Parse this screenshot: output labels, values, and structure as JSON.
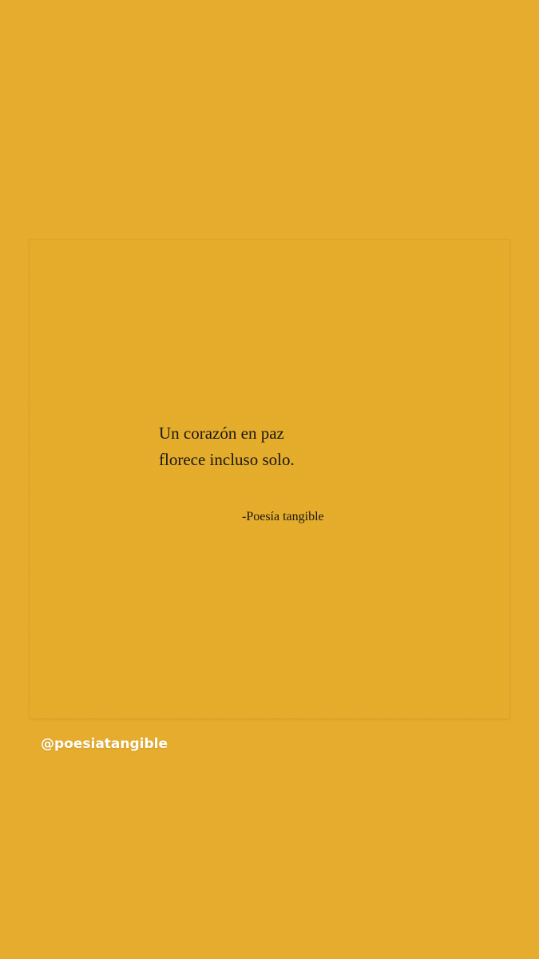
{
  "background_color": "#E6AC2E",
  "post": {
    "quote_lines": [
      "Un corazón en paz",
      "florece incluso solo."
    ],
    "attribution": "-Poesía tangible",
    "card_color": "#E9AF2F",
    "text_color": "#1a1714"
  },
  "mention": {
    "text": "@poesiatangible",
    "color": "#ffffff"
  }
}
